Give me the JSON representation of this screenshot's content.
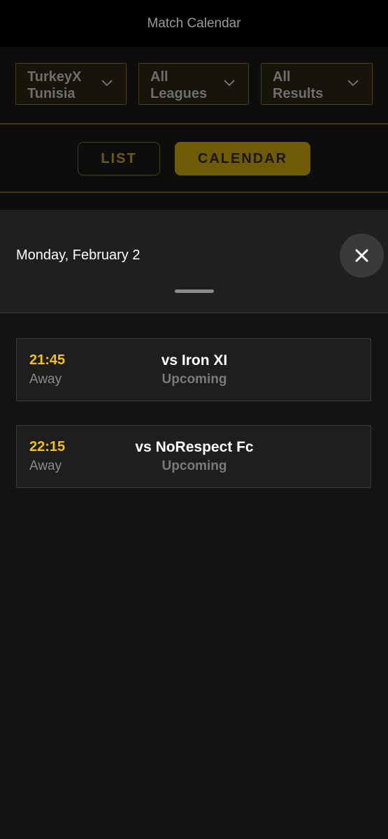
{
  "header": {
    "title": "Match Calendar"
  },
  "filters": [
    {
      "label": "TurkeyX Tunisia"
    },
    {
      "label": "All Leagues"
    },
    {
      "label": "All Results"
    }
  ],
  "view_toggle": {
    "list_label": "LIST",
    "calendar_label": "CALENDAR",
    "selected": "CALENDAR"
  },
  "sheet": {
    "date": "Monday, February 2",
    "matches": [
      {
        "time": "21:45",
        "venue": "Away",
        "opponent": "vs Iron XI",
        "status": "Upcoming"
      },
      {
        "time": "22:15",
        "venue": "Away",
        "opponent": "vs NoRespect Fc",
        "status": "Upcoming"
      }
    ]
  },
  "colors": {
    "accent": "#f4c20d",
    "button_active": "#6e5b08",
    "background": "#121212"
  },
  "icons": {
    "filter_dropdown": "chevron-down-icon",
    "close": "close-icon"
  }
}
